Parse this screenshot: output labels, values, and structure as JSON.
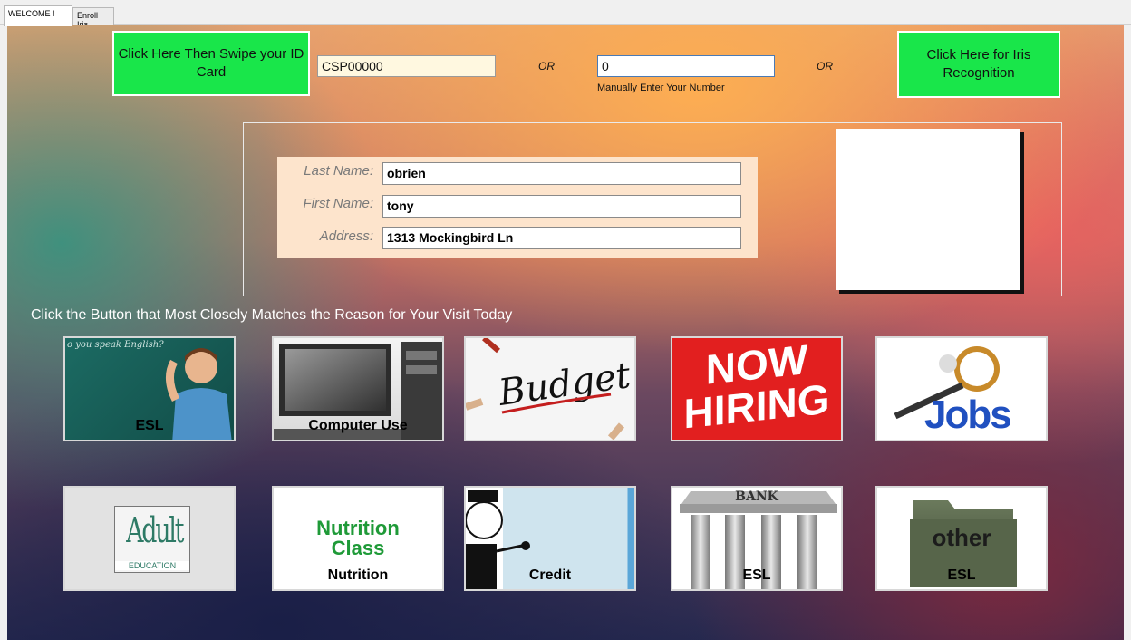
{
  "tabs": [
    "WELCOME !",
    "Enroll Iris"
  ],
  "top": {
    "swipe_button": "Click Here Then Swipe your ID Card",
    "card_value": "CSP00000",
    "or_1": "OR",
    "manual_value": "0",
    "manual_hint": "Manually Enter Your Number",
    "or_2": "OR",
    "iris_button": "Click Here for Iris Recognition"
  },
  "person": {
    "last_name_label": "Last Name:",
    "last_name": "obrien",
    "first_name_label": "First Name:",
    "first_name": "tony",
    "address_label": "Address:",
    "address": "1313 Mockingbird Ln"
  },
  "prompt": "Click the Button that Most Closely Matches the Reason for Your Visit Today",
  "tiles": [
    {
      "label": "ESL",
      "caption": "o you speak English?"
    },
    {
      "label": "Computer Use"
    },
    {
      "label": "",
      "caption": "Budget"
    },
    {
      "label": "",
      "caption_line1": "NOW",
      "caption_line2": "HIRING"
    },
    {
      "label": "",
      "caption": "Jobs"
    },
    {
      "label": "",
      "caption_line1": "Adult",
      "caption_line2": "EDUCATION"
    },
    {
      "label": "Nutrition",
      "caption_line1": "Nutrition",
      "caption_line2": "Class"
    },
    {
      "label": "Credit"
    },
    {
      "label": "ESL",
      "caption": "BANK"
    },
    {
      "label": "ESL",
      "caption": "other"
    }
  ]
}
